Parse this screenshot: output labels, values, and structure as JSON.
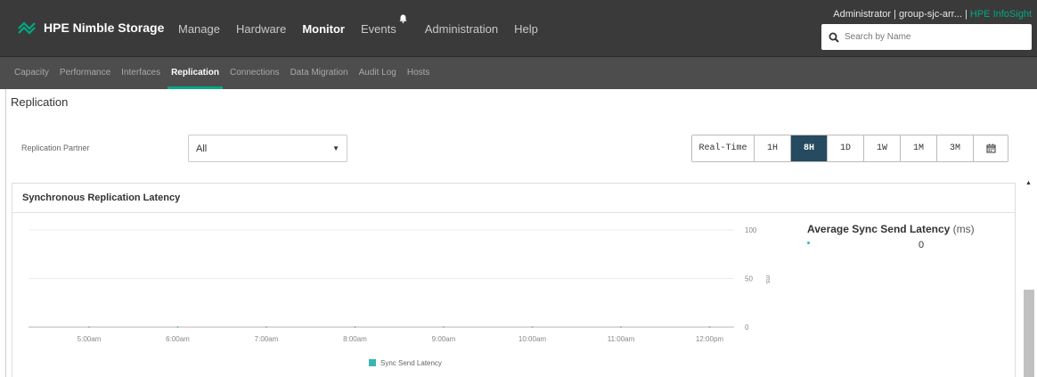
{
  "header": {
    "brand": "HPE Nimble Storage",
    "nav": [
      "Manage",
      "Hardware",
      "Monitor",
      "Events",
      "Administration",
      "Help"
    ],
    "active_nav": "Monitor",
    "user": "Administrator | group-sjc-arr...",
    "separator": " | ",
    "infosight": "HPE InfoSight",
    "search_placeholder": "Search by Name"
  },
  "subnav": {
    "tabs": [
      "Capacity",
      "Performance",
      "Interfaces",
      "Replication",
      "Connections",
      "Data Migration",
      "Audit Log",
      "Hosts"
    ],
    "active": "Replication"
  },
  "page": {
    "title": "Replication",
    "partner_label": "Replication Partner",
    "partner_value": "All",
    "time_ranges": [
      "Real-Time",
      "1H",
      "8H",
      "1D",
      "1W",
      "1M",
      "3M"
    ],
    "active_range": "8H"
  },
  "panel": {
    "title": "Synchronous Replication Latency",
    "legend_title": "Average Sync Send Latency",
    "legend_unit": "(ms)",
    "legend_value": "0"
  },
  "colors": {
    "accent": "#01a982",
    "series": "#3ab5b0",
    "active_segment": "#264a60"
  },
  "chart_data": {
    "type": "line",
    "x": [
      "5:00am",
      "6:00am",
      "7:00am",
      "8:00am",
      "9:00am",
      "10:00am",
      "11:00am",
      "12:00pm"
    ],
    "series": [
      {
        "name": "Sync Send Latency",
        "values": [
          0,
          0,
          0,
          0,
          0,
          0,
          0,
          0
        ]
      }
    ],
    "yticks": [
      "100",
      "50",
      "0"
    ],
    "ylim": [
      0,
      100
    ],
    "ylabel": "ms",
    "legend": "bottom"
  }
}
